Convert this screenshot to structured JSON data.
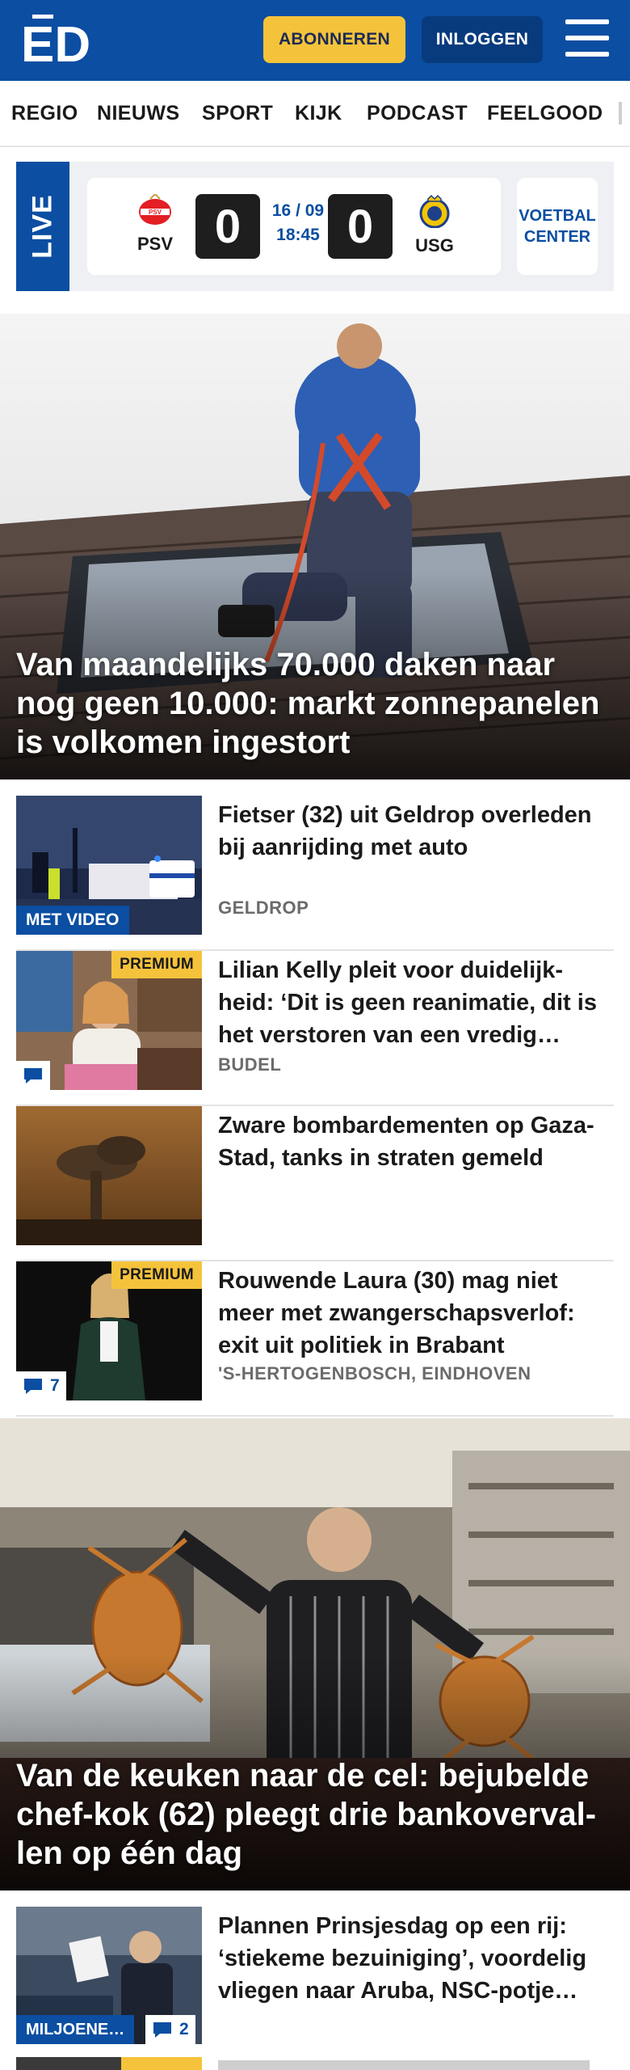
{
  "header": {
    "logo_text": "ED",
    "subscribe_label": "ABONNEREN",
    "login_label": "INLOGGEN",
    "brand_color": "#0b4ea2",
    "accent_color": "#f5c33b"
  },
  "nav": {
    "items": [
      "REGIO",
      "NIEUWS",
      "SPORT",
      "KIJK",
      "PODCAST",
      "FEELGOOD"
    ]
  },
  "live": {
    "label": "LIVE",
    "home_team": "PSV",
    "away_team": "USG",
    "home_score": "0",
    "away_score": "0",
    "date": "16 / 09",
    "time": "18:45",
    "center_label": "VOETBAL CENTER"
  },
  "hero1": {
    "title": "Van maandelijks 70.000 daken naar nog geen 10.000: markt zonnepanelen is volkomen ingestort"
  },
  "articles": [
    {
      "title": "Fietser (32) uit Geldrop overleden bij aanrijding met auto",
      "location": "GELDROP",
      "badge": "MET VIDEO"
    },
    {
      "title": "Lilian Kelly pleit voor duidelijk­heid: ‘Dit is geen reanimatie, dit is het verstoren van een vredig…",
      "location": "BUDEL",
      "badge": "PREMIUM"
    },
    {
      "title": "Zware bombardementen op Ga­za-Stad, tanks in straten gemeld",
      "location": ""
    },
    {
      "title": "Rouwende Laura (30) mag niet meer met zwangerschapsverlof: exit uit politiek in Brabant",
      "location": "'S-HERTOGENBOSCH, EINDHOVEN",
      "badge": "PREMIUM",
      "comments": "7"
    }
  ],
  "hero2": {
    "title": "Van de keuken naar de cel: bejubelde chef-kok (62) pleegt drie bankoverval­len op één dag"
  },
  "article5": {
    "title": "Plannen Prinsjesdag op een rij: ‘stiekeme bezuiniging’, voordelig vliegen naar Aruba, NSC-potje…",
    "section": "MILJOENE…",
    "comments": "2"
  }
}
